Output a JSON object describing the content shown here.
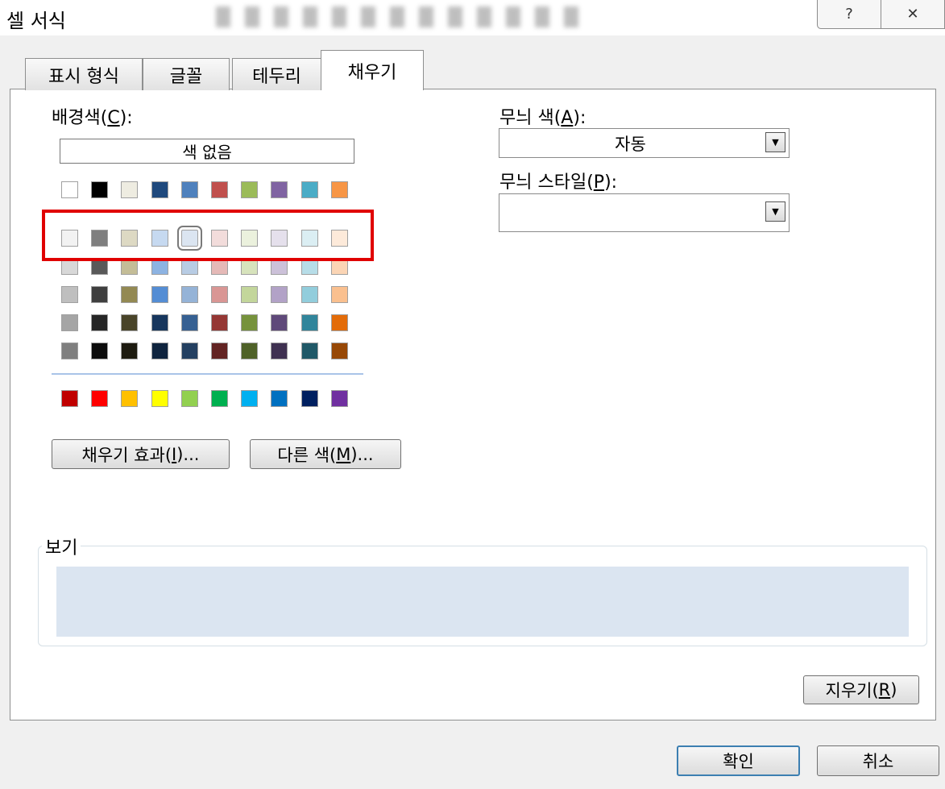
{
  "window": {
    "title": "셀 서식",
    "help_icon": "help-icon",
    "close_icon": "close-icon"
  },
  "tabs": [
    {
      "label": "표시 형식",
      "active": false
    },
    {
      "label": "글꼴",
      "active": false
    },
    {
      "label": "테두리",
      "active": false
    },
    {
      "label": "채우기",
      "active": true
    }
  ],
  "background": {
    "label_prefix": "배경색(",
    "label_key": "C",
    "label_suffix": "):",
    "no_color": "색 없음",
    "theme_colors": [
      [
        "#ffffff",
        "#000000",
        "#eeece1",
        "#1f497d",
        "#4f81bd",
        "#c0504d",
        "#9bbb59",
        "#8064a2",
        "#4bacc6",
        "#f79646"
      ],
      [
        "#f2f2f2",
        "#7f7f7f",
        "#ddd9c3",
        "#c6d9f0",
        "#dbe5f1",
        "#f2dcdb",
        "#ebf1dd",
        "#e5e0ec",
        "#dbeef3",
        "#fdeada"
      ],
      [
        "#d8d8d8",
        "#595959",
        "#c4bd97",
        "#8db3e2",
        "#b8cce4",
        "#e5b9b7",
        "#d7e3bc",
        "#ccc1d9",
        "#b7dde8",
        "#fbd5b5"
      ],
      [
        "#bfbfbf",
        "#3f3f3f",
        "#938953",
        "#548dd4",
        "#95b3d7",
        "#d99694",
        "#c3d69b",
        "#b2a2c7",
        "#92cddc",
        "#fac08f"
      ],
      [
        "#a5a5a5",
        "#262626",
        "#494429",
        "#17365d",
        "#366092",
        "#953734",
        "#76923c",
        "#5f497a",
        "#31859b",
        "#e36c09"
      ],
      [
        "#7f7f7f",
        "#0c0c0c",
        "#1d1b10",
        "#0f243e",
        "#244061",
        "#632423",
        "#4f6128",
        "#3f3151",
        "#205867",
        "#974806"
      ]
    ],
    "standard_colors": [
      "#c00000",
      "#ff0000",
      "#ffc000",
      "#ffff00",
      "#92d050",
      "#00b050",
      "#00b0f0",
      "#0070c0",
      "#002060",
      "#7030a0"
    ],
    "selected": {
      "row": 1,
      "col": 4
    }
  },
  "buttons": {
    "fill_effects_prefix": "채우기 효과(",
    "fill_effects_key": "I",
    "fill_effects_suffix": ")...",
    "more_colors_prefix": "다른 색(",
    "more_colors_key": "M",
    "more_colors_suffix": ")...",
    "clear_prefix": "지우기(",
    "clear_key": "R",
    "clear_suffix": ")",
    "ok": "확인",
    "cancel": "취소"
  },
  "pattern_color": {
    "label_prefix": "무늬 색(",
    "label_key": "A",
    "label_suffix": "):",
    "value": "자동"
  },
  "pattern_style": {
    "label_prefix": "무늬 스타일(",
    "label_key": "P",
    "label_suffix": "):",
    "value": ""
  },
  "preview": {
    "label": "보기",
    "color": "#dbe5f1"
  }
}
